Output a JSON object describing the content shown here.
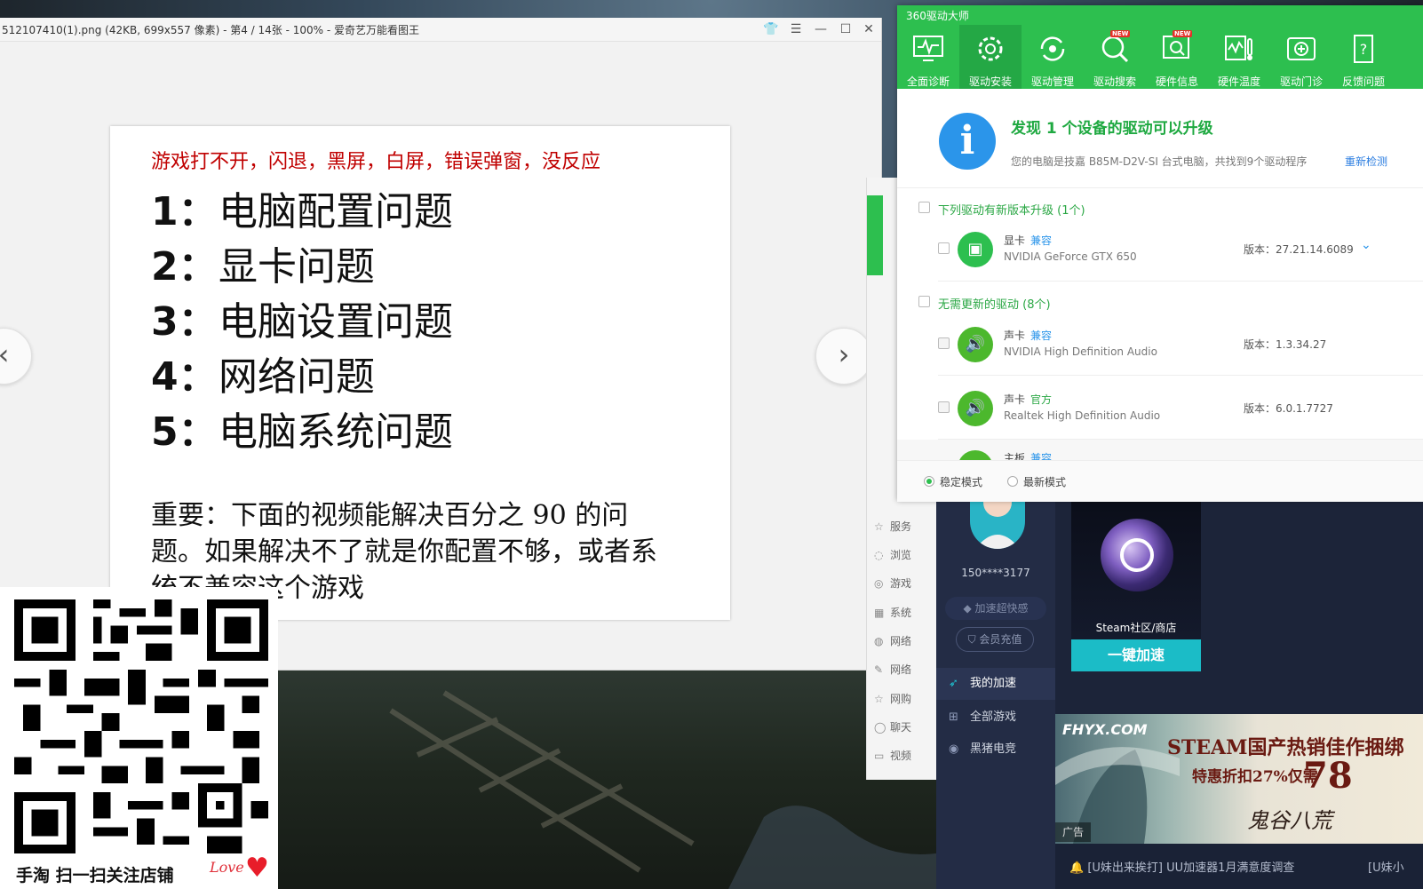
{
  "viewer": {
    "title": "512107410(1).png (42KB, 699x557 像素) - 第4 / 14张 - 100% - 爱奇艺万能看图王",
    "slide": {
      "headline": "游戏打不开，闪退，黑屏，白屏，错误弹窗，没反应",
      "items": [
        {
          "num": "1：",
          "text": "电脑配置问题"
        },
        {
          "num": "2：",
          "text": "显卡问题"
        },
        {
          "num": "3：",
          "text": "电脑设置问题"
        },
        {
          "num": "4：",
          "text": "网络问题"
        },
        {
          "num": "5：",
          "text": "电脑系统问题"
        }
      ],
      "note": "重要：下面的视频能解决百分之 90 的问题。如果解决不了就是你配置不够，或者系统不兼容这个游戏"
    },
    "prev_glyph": "‹",
    "next_glyph": "›"
  },
  "qr": {
    "caption": "手淘 扫一扫关注店铺",
    "love": "Love",
    "heart": "♥"
  },
  "side_window": {
    "items": [
      "服务",
      "浏览",
      "游戏",
      "系统",
      "网络",
      "网络",
      "网购",
      "聊天",
      "视频"
    ]
  },
  "driver": {
    "app_title": "360驱动大师",
    "toolbar": [
      {
        "label": "全面诊断",
        "icon": "pulse-monitor-icon"
      },
      {
        "label": "驱动安装",
        "icon": "gear-icon",
        "active": true
      },
      {
        "label": "驱动管理",
        "icon": "refresh-icon"
      },
      {
        "label": "驱动搜索",
        "icon": "search-icon",
        "new": "NEW"
      },
      {
        "label": "硬件信息",
        "icon": "hardware-search-icon",
        "new": "NEW"
      },
      {
        "label": "硬件温度",
        "icon": "thermometer-icon"
      },
      {
        "label": "驱动门诊",
        "icon": "first-aid-icon"
      },
      {
        "label": "反馈问题",
        "icon": "question-icon"
      }
    ],
    "found": "发现 1 个设备的驱动可以升级",
    "desc": "您的电脑是技嘉 B85M-D2V-SI 台式电脑，共找到9个驱动程序",
    "recheck": "重新检测",
    "group_upgrade": "下列驱动有新版本升级 (1个)",
    "group_ok": "无需更新的驱动 (8个)",
    "devices": [
      {
        "type": "显卡",
        "tag": "兼容",
        "name": "NVIDIA GeForce GTX 650",
        "version": "版本：27.21.14.6089",
        "color": "#2dbf4f"
      },
      {
        "type": "声卡",
        "tag": "兼容",
        "name": "NVIDIA High Definition Audio",
        "version": "版本：1.3.34.27",
        "color": "#2dbf4f"
      },
      {
        "type": "声卡",
        "tag": "官方",
        "name": "Realtek High Definition Audio",
        "version": "版本：6.0.1.7727",
        "color": "#2dbf4f"
      },
      {
        "type": "主板",
        "tag": "兼容"
      }
    ],
    "mode_stable": "稳定模式",
    "mode_latest": "最新模式"
  },
  "uu": {
    "phone": "150****3177",
    "speed_badge": "加速超快感",
    "recharge": "会员充值",
    "nav": [
      "我的加速",
      "全部游戏",
      "黑猪电竞"
    ],
    "game_label": "Steam社区/商店",
    "accel_button": "一键加速",
    "ad": {
      "logo": "FHYX.COM",
      "line1": "STEAM国产热销佳作捆绑",
      "line2": "特惠折扣27%仅需",
      "big": "78",
      "brand": "鬼谷八荒",
      "tag": "广告"
    },
    "status": "[U妹出来挨打] UU加速器1月满意度调查",
    "status2": "[U妹小"
  }
}
